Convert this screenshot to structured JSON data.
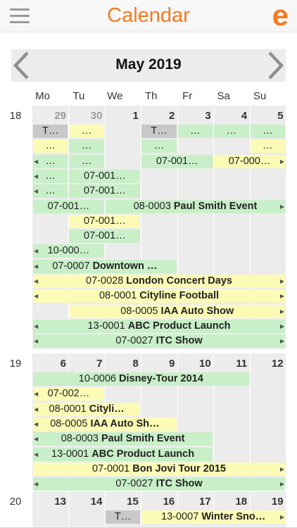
{
  "header": {
    "title": "Calendar",
    "brand_logo": "e",
    "menu_icon": "hamburger-menu-icon",
    "accent": "#f47a20"
  },
  "nav": {
    "month_title": "May 2019",
    "prev_icon": "chevron-left-icon",
    "next_icon": "chevron-right-icon"
  },
  "weekdays": [
    "Mo",
    "Tu",
    "We",
    "Th",
    "Fr",
    "Sa",
    "Su"
  ],
  "colors": {
    "green": "#c8efc8",
    "yellow": "#fbfbb6",
    "gray": "#c8c8c8"
  },
  "weeks": [
    {
      "week_number": "18",
      "days": [
        {
          "label": "29",
          "other_month": true
        },
        {
          "label": "30",
          "other_month": true
        },
        {
          "label": "1",
          "other_month": false
        },
        {
          "label": "2",
          "other_month": false
        },
        {
          "label": "3",
          "other_month": false
        },
        {
          "label": "4",
          "other_month": false
        },
        {
          "label": "5",
          "other_month": false
        }
      ],
      "events": [
        {
          "row": 0,
          "start": 0,
          "span": 1,
          "color": "gray",
          "code": "T…",
          "title": ""
        },
        {
          "row": 0,
          "start": 1,
          "span": 1,
          "color": "yellow",
          "code": "…",
          "title": ""
        },
        {
          "row": 0,
          "start": 3,
          "span": 1,
          "color": "gray",
          "code": "T…",
          "title": ""
        },
        {
          "row": 0,
          "start": 4,
          "span": 1,
          "color": "green",
          "code": "…",
          "title": ""
        },
        {
          "row": 0,
          "start": 5,
          "span": 1,
          "color": "green",
          "code": "…",
          "title": ""
        },
        {
          "row": 0,
          "start": 6,
          "span": 1,
          "color": "green",
          "code": "…",
          "title": ""
        },
        {
          "row": 1,
          "start": 0,
          "span": 1,
          "color": "yellow",
          "code": "…",
          "title": ""
        },
        {
          "row": 1,
          "start": 1,
          "span": 1,
          "color": "green",
          "code": "…",
          "title": ""
        },
        {
          "row": 1,
          "start": 3,
          "span": 1,
          "color": "green",
          "code": "…",
          "title": ""
        },
        {
          "row": 1,
          "start": 6,
          "span": 1,
          "color": "yellow",
          "code": "…",
          "title": ""
        },
        {
          "row": 2,
          "start": 0,
          "span": 1,
          "color": "green",
          "code": "…",
          "title": "",
          "cont_left": true
        },
        {
          "row": 2,
          "start": 1,
          "span": 1,
          "color": "green",
          "code": "…",
          "title": ""
        },
        {
          "row": 2,
          "start": 3,
          "span": 2,
          "color": "green",
          "code": "07-001…",
          "title": ""
        },
        {
          "row": 2,
          "start": 5,
          "span": 2,
          "color": "yellow",
          "code": "07-000…",
          "title": "",
          "cont_right": true
        },
        {
          "row": 3,
          "start": 0,
          "span": 1,
          "color": "green",
          "code": "…",
          "title": "",
          "cont_left": true
        },
        {
          "row": 3,
          "start": 1,
          "span": 2,
          "color": "green",
          "code": "07-001…",
          "title": ""
        },
        {
          "row": 4,
          "start": 0,
          "span": 1,
          "color": "green",
          "code": "…",
          "title": "",
          "cont_left": true
        },
        {
          "row": 4,
          "start": 1,
          "span": 2,
          "color": "green",
          "code": "07-001…",
          "title": ""
        },
        {
          "row": 5,
          "start": 0,
          "span": 2,
          "color": "green",
          "code": "07-001…",
          "title": ""
        },
        {
          "row": 5,
          "start": 2,
          "span": 5,
          "color": "green",
          "code": "08-0003",
          "title": "Paul Smith Event",
          "cont_right": true
        },
        {
          "row": 6,
          "start": 1,
          "span": 2,
          "color": "yellow",
          "code": "07-001…",
          "title": ""
        },
        {
          "row": 7,
          "start": 1,
          "span": 2,
          "color": "green",
          "code": "07-001…",
          "title": ""
        },
        {
          "row": 8,
          "start": 0,
          "span": 2,
          "color": "green",
          "code": "10-000…",
          "title": "",
          "cont_left": true
        },
        {
          "row": 9,
          "start": 0,
          "span": 4,
          "color": "green",
          "code": "07-0007",
          "title": "Downtown …",
          "cont_left": true
        },
        {
          "row": 10,
          "start": 0,
          "span": 7,
          "color": "yellow",
          "code": "07-0028",
          "title": "London Concert Days",
          "cont_left": true,
          "cont_right": true
        },
        {
          "row": 11,
          "start": 0,
          "span": 7,
          "color": "yellow",
          "code": "08-0001",
          "title": "Cityline Football",
          "cont_left": true,
          "cont_right": true
        },
        {
          "row": 12,
          "start": 1,
          "span": 6,
          "color": "yellow",
          "code": "08-0005",
          "title": "IAA Auto Show",
          "cont_right": true
        },
        {
          "row": 13,
          "start": 0,
          "span": 7,
          "color": "green",
          "code": "13-0001",
          "title": "ABC Product Launch",
          "cont_left": true,
          "cont_right": true
        },
        {
          "row": 14,
          "start": 0,
          "span": 7,
          "color": "green",
          "code": "07-0027",
          "title": "ITC Show",
          "cont_left": true,
          "cont_right": true
        }
      ]
    },
    {
      "week_number": "19",
      "days": [
        {
          "label": "6",
          "other_month": false
        },
        {
          "label": "7",
          "other_month": false
        },
        {
          "label": "8",
          "other_month": false
        },
        {
          "label": "9",
          "other_month": false
        },
        {
          "label": "10",
          "other_month": false
        },
        {
          "label": "11",
          "other_month": false
        },
        {
          "label": "12",
          "other_month": false
        }
      ],
      "events": [
        {
          "row": 0,
          "start": 0,
          "span": 6,
          "color": "green",
          "code": "10-0006",
          "title": "Disney-Tour 2014"
        },
        {
          "row": 1,
          "start": 0,
          "span": 2,
          "color": "yellow",
          "code": "07-002…",
          "title": "",
          "cont_left": true
        },
        {
          "row": 2,
          "start": 0,
          "span": 3,
          "color": "yellow",
          "code": "08-0001",
          "title": "Cityli…",
          "cont_left": true
        },
        {
          "row": 3,
          "start": 0,
          "span": 4,
          "color": "yellow",
          "code": "08-0005",
          "title": "IAA Auto Sh…",
          "cont_left": true
        },
        {
          "row": 4,
          "start": 0,
          "span": 5,
          "color": "green",
          "code": "08-0003",
          "title": "Paul Smith Event",
          "cont_left": true
        },
        {
          "row": 5,
          "start": 0,
          "span": 5,
          "color": "green",
          "code": "13-0001",
          "title": "ABC Product Launch",
          "cont_left": true
        },
        {
          "row": 6,
          "start": 0,
          "span": 7,
          "color": "yellow",
          "code": "07-0001",
          "title": "Bon Jovi Tour 2015",
          "cont_right": true
        },
        {
          "row": 7,
          "start": 0,
          "span": 7,
          "color": "green",
          "code": "07-0027",
          "title": "ITC Show",
          "cont_left": true,
          "cont_right": true
        }
      ]
    },
    {
      "week_number": "20",
      "days": [
        {
          "label": "13",
          "other_month": false
        },
        {
          "label": "14",
          "other_month": false
        },
        {
          "label": "15",
          "other_month": false
        },
        {
          "label": "16",
          "other_month": false
        },
        {
          "label": "17",
          "other_month": false
        },
        {
          "label": "18",
          "other_month": false
        },
        {
          "label": "19",
          "other_month": false
        }
      ],
      "events": [
        {
          "row": 0,
          "start": 2,
          "span": 1,
          "color": "gray",
          "code": "T…",
          "title": ""
        },
        {
          "row": 0,
          "start": 3,
          "span": 4,
          "color": "yellow",
          "code": "13-0007",
          "title": "Winter Sno…",
          "cont_right": true
        }
      ]
    }
  ]
}
